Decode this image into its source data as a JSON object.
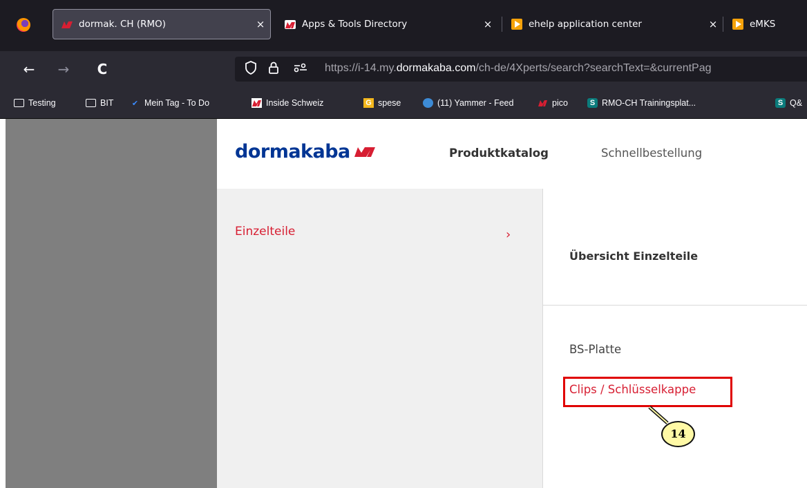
{
  "browser": {
    "tabs": [
      {
        "title": "dormak. CH (RMO)",
        "close": "×",
        "favicon": "dormakaba-icon",
        "active": true
      },
      {
        "title": "Apps & Tools Directory",
        "close": "×",
        "favicon": "dormakaba-icon",
        "active": false
      },
      {
        "title": "ehelp application center",
        "close": "×",
        "favicon": "play-icon",
        "active": false
      },
      {
        "title": "eMKS",
        "close": "",
        "favicon": "play-icon",
        "active": false
      }
    ],
    "nav": {
      "back": "←",
      "forward": "→",
      "reload": "C"
    },
    "url": {
      "prefix": "https://i-14.my.",
      "domain": "dormakaba.com",
      "suffix": "/ch-de/4Xperts/search?searchText=&currentPag"
    },
    "bookmarks": [
      {
        "label": "Testing",
        "icon": "folder-icon"
      },
      {
        "label": "BIT",
        "icon": "folder-icon"
      },
      {
        "label": "Mein Tag - To Do",
        "icon": "checkmark-icon"
      },
      {
        "label": "Inside Schweiz",
        "icon": "dormakaba-icon"
      },
      {
        "label": "spese",
        "icon": "g-icon"
      },
      {
        "label": "(11) Yammer - Feed",
        "icon": "yammer-icon"
      },
      {
        "label": "pico",
        "icon": "dormakaba-icon"
      },
      {
        "label": "RMO-CH Trainingsplat...",
        "icon": "sharepoint-icon"
      },
      {
        "label": "Q&",
        "icon": "sharepoint-icon"
      }
    ]
  },
  "site": {
    "logo": "dormakaba",
    "nav": {
      "catalog": "Produktkatalog",
      "quick_order": "Schnellbestellung"
    },
    "category_menu": {
      "item": "Einzelteile",
      "chevron": "›"
    },
    "content": {
      "title": "Übersicht Einzelteile",
      "items": [
        "BS-Platte",
        "Clips / Schlüsselkappe"
      ]
    }
  },
  "annotation": {
    "step": "14"
  },
  "colors": {
    "brand_blue": "#003594",
    "brand_red": "#d71e32",
    "highlight_red": "#e00000",
    "callout_yellow": "#fff9a6"
  }
}
